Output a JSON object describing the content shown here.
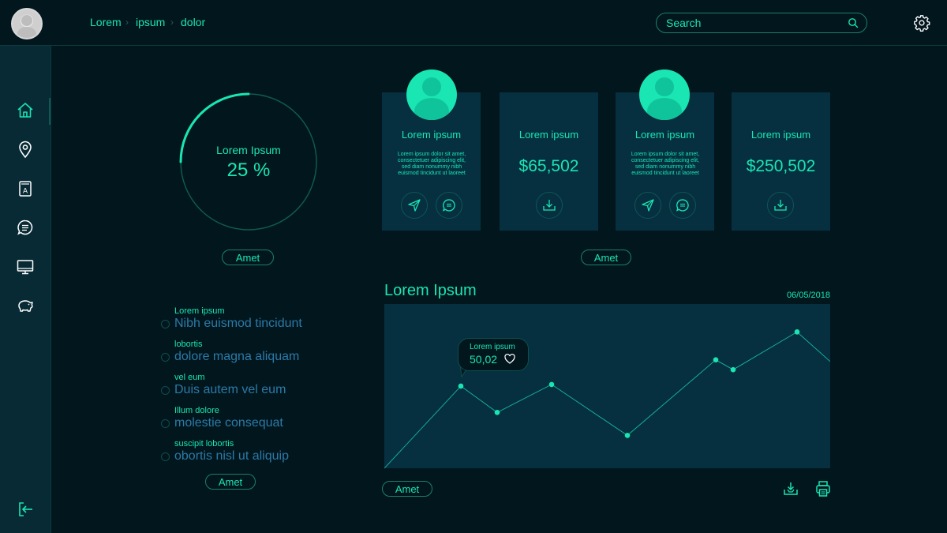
{
  "header": {
    "breadcrumb": [
      "Lorem",
      "ipsum",
      "dolor"
    ],
    "search_placeholder": "Search",
    "settings_icon": "gear-icon",
    "avatar_icon": "user-avatar"
  },
  "sidebar": {
    "items": [
      {
        "icon": "home-icon"
      },
      {
        "icon": "location-pin-icon"
      },
      {
        "icon": "address-book-icon"
      },
      {
        "icon": "chat-icon"
      },
      {
        "icon": "monitor-icon"
      },
      {
        "icon": "piggy-bank-icon"
      }
    ],
    "logout_icon": "logout-icon"
  },
  "gauge": {
    "label": "Lorem Ipsum",
    "value_text": "25 %",
    "value": 0.25,
    "button": "Amet"
  },
  "cards": [
    {
      "type": "profile",
      "title": "Lorem ipsum",
      "text": "Lorem ipsum dolor sit amet, consectetuer adipiscing elit, sed diam nonummy nibh euismod tincidunt ut laoreet"
    },
    {
      "type": "amount",
      "title": "Lorem ipsum",
      "amount": "$65,502"
    },
    {
      "type": "profile",
      "title": "Lorem ipsum",
      "text": "Lorem ipsum dolor sit amet, consectetuer adipiscing elit, sed diam nonummy nibh euismod tincidunt ut laoreet"
    },
    {
      "type": "amount",
      "title": "Lorem ipsum",
      "amount": "$250,502"
    }
  ],
  "cards_button": "Amet",
  "list": {
    "items": [
      {
        "top": "Lorem ipsum",
        "main": "Nibh euismod tincidunt"
      },
      {
        "top": "lobortis",
        "main": "dolore magna aliquam"
      },
      {
        "top": "vel eum",
        "main": "Duis autem vel eum"
      },
      {
        "top": "Illum dolore",
        "main": "molestie consequat"
      },
      {
        "top": "suscipit lobortis",
        "main": "obortis nisl ut aliquip"
      }
    ],
    "button": "Amet"
  },
  "chart_panel": {
    "title": "Lorem Ipsum",
    "date": "06/05/2018",
    "tooltip_label": "Lorem ipsum",
    "tooltip_value": "50,02",
    "button": "Amet",
    "download_icon": "download-icon",
    "print_icon": "printer-icon"
  },
  "colors": {
    "accent": "#19e6b3",
    "background": "#02161d",
    "panel": "#063040",
    "sidebar": "#072a35",
    "list_text": "#2b7aa8"
  },
  "chart_data": {
    "type": "line",
    "x": [
      0,
      1,
      2,
      3,
      4,
      5,
      6,
      7,
      8
    ],
    "values": [
      0,
      50.02,
      34,
      51,
      20,
      66,
      60,
      83,
      65
    ],
    "marked_points": [
      1,
      2,
      3,
      4,
      5,
      6,
      7
    ],
    "ylim": [
      0,
      100
    ],
    "grid": false
  }
}
